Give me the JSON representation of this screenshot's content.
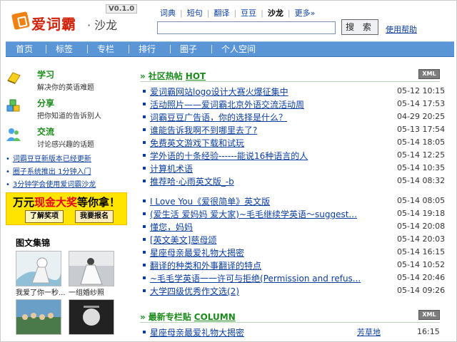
{
  "header": {
    "logo_name": "爱词霸",
    "logo_sub": "· 沙龙",
    "version": "V0.1.0",
    "topnav": [
      {
        "label": "词典",
        "current": false
      },
      {
        "label": "短句",
        "current": false
      },
      {
        "label": "翻译",
        "current": false
      },
      {
        "label": "豆豆",
        "current": false
      },
      {
        "label": "沙龙",
        "current": true
      },
      {
        "label": "更多»",
        "current": false
      }
    ],
    "search_value": "",
    "search_button": "搜 索",
    "help_link": "使用帮助"
  },
  "mainnav": [
    "首页",
    "标签",
    "专栏",
    "排行",
    "圈子",
    "个人空间"
  ],
  "left": {
    "features": [
      {
        "title": "学习",
        "desc": "解决你的英语难题"
      },
      {
        "title": "分享",
        "desc": "把你知道的告诉别人"
      },
      {
        "title": "交流",
        "desc": "讨论感兴趣的话题"
      }
    ],
    "news": [
      "词霸豆豆新版本已经更新",
      "圈子系统推出 1分钟入门",
      "3分钟学会使用爱词霸沙龙"
    ],
    "promo": {
      "title_pre": "万元",
      "title_em": "现金大奖",
      "title_post": "等你拿！",
      "button1": "了解奖项",
      "button2": "我要报名"
    },
    "gallery_title": "图文集锦",
    "gallery": [
      {
        "caption": "我爱了你一秒..."
      },
      {
        "caption": "一组婚纱照"
      },
      {
        "caption": ""
      },
      {
        "caption": ""
      }
    ]
  },
  "hot": {
    "title": "社区热帖",
    "title_en": "HOT",
    "xml": "XML",
    "posts": [
      {
        "title": "爱词霸网站logo设计大赛火爆征集中",
        "date": "05-12 10:15"
      },
      {
        "title": "活动照片——爱词霸北京外语交流活动周",
        "date": "05-14 17:53"
      },
      {
        "title": "词霸豆豆广告语，你的选择是什么？",
        "date": "04-29 20:25"
      },
      {
        "title": "谁能告诉我啊不到哪里去了?",
        "date": "05-13 17:54"
      },
      {
        "title": "免费英文游戏下载和试玩",
        "date": "05-14 18:05"
      },
      {
        "title": "学外语的十条经验------能说16种语言的人",
        "date": "05-14 12:25"
      },
      {
        "title": "计算机术语",
        "date": "05-14 10:35"
      },
      {
        "title": "推荐哈·心雨英文版_-b",
        "date": "05-14 08:32"
      },
      {
        "title": "I Love You《爱很简单》英文版",
        "date": "05-14 08:05"
      },
      {
        "title": "(爱生活 爱妈妈 爱大家)~毛毛继续学英语～suggest...",
        "date": "05-14 19:18"
      },
      {
        "title": "懂您，妈妈",
        "date": "05-14 20:08"
      },
      {
        "title": "[英文美文]慈母颂",
        "date": "05-14 20:03"
      },
      {
        "title": "星座母亲最爱礼物大揭密",
        "date": "05-14 16:15"
      },
      {
        "title": "翻译的种类和外事翻译的特点",
        "date": "05-14 10:52"
      },
      {
        "title": "~毛毛学英语一一许可与拒绝(Permission and refus...",
        "date": "05-14 20:46"
      },
      {
        "title": "大学四级优秀作文选(2)",
        "date": "05-14 09:26"
      }
    ]
  },
  "column": {
    "title": "最新专栏贴",
    "title_en": "COLUMN",
    "xml": "XML",
    "posts": [
      {
        "title": "星座母亲最爱礼物大揭密",
        "author": "芳草地",
        "date": "16:15"
      }
    ]
  },
  "colors": {
    "nav_bg": "#5a95d6",
    "link": "#0b3e9e",
    "accent_green": "#1a8a1a",
    "logo_red": "#d0240c",
    "promo_yellow": "#ffe400"
  }
}
